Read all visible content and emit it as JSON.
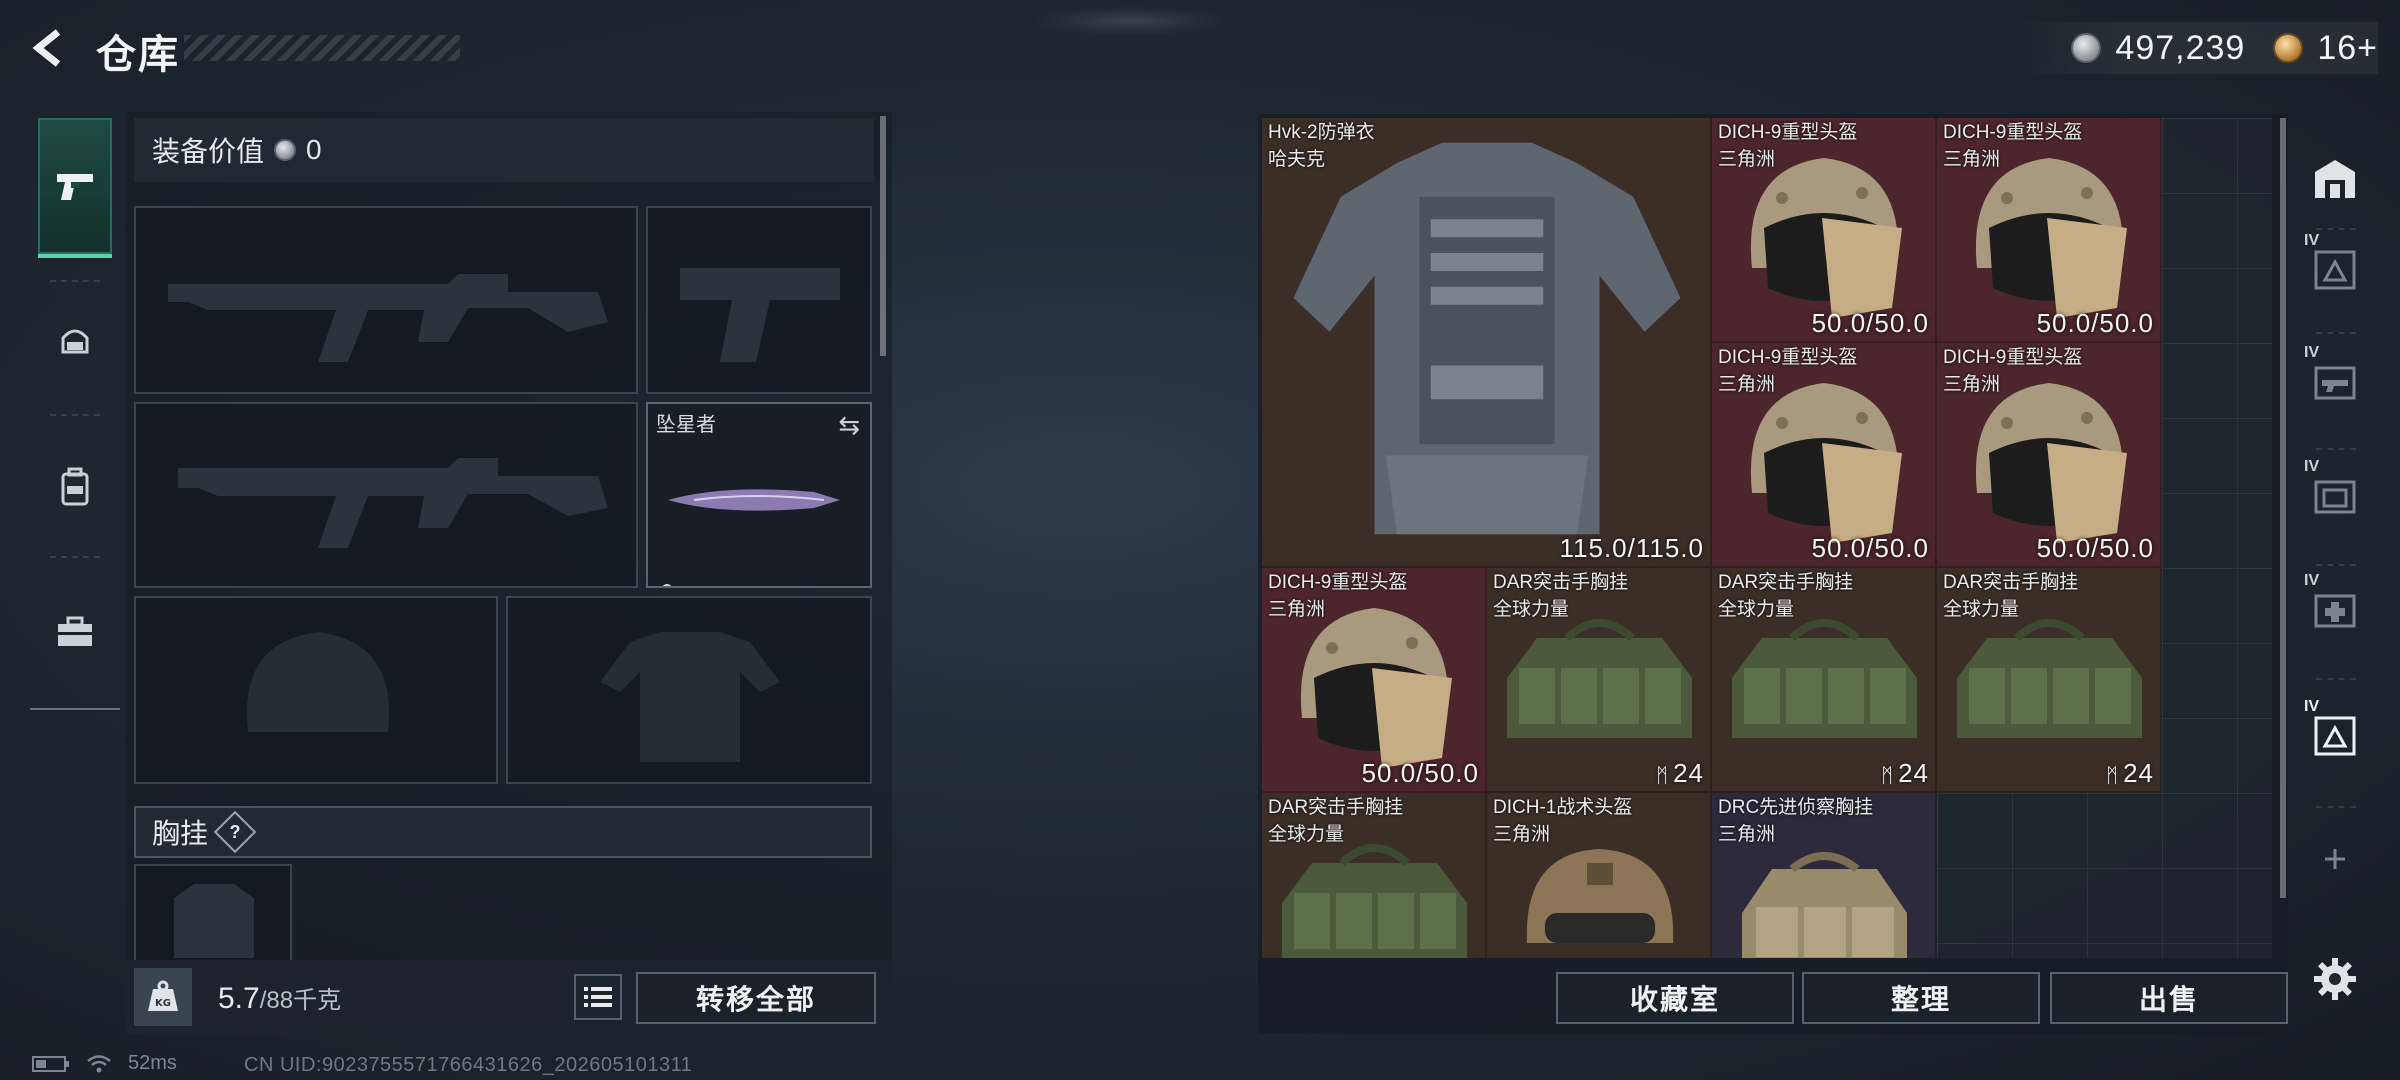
{
  "header": {
    "title": "仓库",
    "currency_silver": "497,239",
    "currency_gold": "16+"
  },
  "equipment": {
    "value_label": "装备价值",
    "value": "0",
    "melee_name": "坠星者",
    "vest_section_label": "胸挂",
    "help_label": "?"
  },
  "weight": {
    "current": "5.7",
    "capacity": "/88千克"
  },
  "buttons": {
    "transfer_all": "转移全部",
    "collection": "收藏室",
    "organize": "整理",
    "sell": "出售"
  },
  "inventory": {
    "items": [
      {
        "name": "Hvk-2防弹衣",
        "sub": "哈夫克",
        "value": "115.0/115.0",
        "rarity": "brown",
        "icon": "armor-vest"
      },
      {
        "name": "DICH-9重型头盔",
        "sub": "三角洲",
        "value": "50.0/50.0",
        "rarity": "red",
        "icon": "heavy-helmet"
      },
      {
        "name": "DICH-9重型头盔",
        "sub": "三角洲",
        "value": "50.0/50.0",
        "rarity": "red",
        "icon": "heavy-helmet"
      },
      {
        "name": "DICH-9重型头盔",
        "sub": "三角洲",
        "value": "50.0/50.0",
        "rarity": "red",
        "icon": "heavy-helmet"
      },
      {
        "name": "DICH-9重型头盔",
        "sub": "三角洲",
        "value": "50.0/50.0",
        "rarity": "red",
        "icon": "heavy-helmet"
      },
      {
        "name": "DICH-9重型头盔",
        "sub": "三角洲",
        "value": "50.0/50.0",
        "rarity": "red",
        "icon": "heavy-helmet"
      },
      {
        "name": "DAR突击手胸挂",
        "sub": "全球力量",
        "value": "24",
        "rarity": "brown",
        "icon": "chest-rig"
      },
      {
        "name": "DAR突击手胸挂",
        "sub": "全球力量",
        "value": "24",
        "rarity": "brown",
        "icon": "chest-rig"
      },
      {
        "name": "DAR突击手胸挂",
        "sub": "全球力量",
        "value": "24",
        "rarity": "brown",
        "icon": "chest-rig"
      },
      {
        "name": "DAR突击手胸挂",
        "sub": "全球力量",
        "value": "",
        "rarity": "brown",
        "icon": "chest-rig"
      },
      {
        "name": "DICH-1战术头盔",
        "sub": "三角洲",
        "value": "",
        "rarity": "brown",
        "icon": "tactical-helmet"
      },
      {
        "name": "DRC先进侦察胸挂",
        "sub": "三角洲",
        "value": "",
        "rarity": "purple",
        "icon": "recon-rig"
      }
    ]
  },
  "status": {
    "ping": "52ms",
    "uid": "CN UID:9023755571766431626_202605101311"
  },
  "icons": {
    "back": "back-arrow-icon",
    "sidebar": [
      "pistol-icon",
      "helmet-icon",
      "backpack-icon",
      "toolbox-icon"
    ],
    "right_sidebar": [
      "warehouse-icon",
      "tier4-helmet-icon",
      "tier4-gun-icon",
      "tier4-folder-icon",
      "tier4-medkit-icon",
      "tier4-armor-icon",
      "add-icon",
      "settings-icon"
    ]
  },
  "colors": {
    "accent_green": "#5fd3a8",
    "rarity_red": "#4c262c",
    "rarity_brown": "#3b2e27",
    "rarity_purple": "#2d2a3c"
  }
}
